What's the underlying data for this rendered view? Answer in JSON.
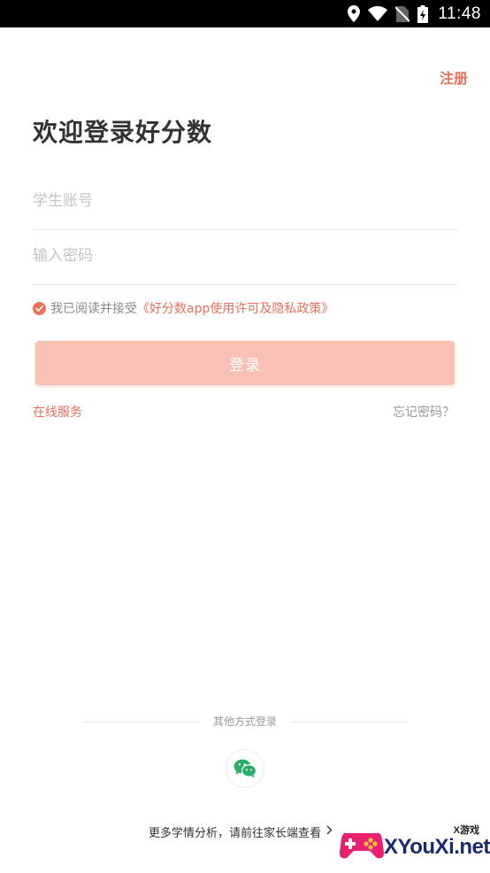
{
  "status_bar": {
    "time": "11:48",
    "icons": [
      "location-icon",
      "wifi-icon",
      "no-sim-icon",
      "battery-icon"
    ]
  },
  "header": {
    "register_label": "注册"
  },
  "main": {
    "title": "欢迎登录好分数",
    "account_placeholder": "学生账号",
    "password_placeholder": "输入密码",
    "agreement_prefix": "我已阅读并接受",
    "agreement_link": "《好分数app使用许可及隐私政策》",
    "agreement_checked": true,
    "login_label": "登录",
    "online_service_label": "在线服务",
    "forgot_password_label": "忘记密码？"
  },
  "footer": {
    "other_login_label": "其他方式登录",
    "wechat_icon": "wechat-icon",
    "parent_hint": "更多学情分析，请前往家长端查看"
  },
  "watermark": {
    "small_text": "X游戏",
    "big_text": "XYouXi.net"
  },
  "colors": {
    "accent": "#e8705a",
    "login_button": "#f9c1b6",
    "wechat": "#2aae67"
  }
}
